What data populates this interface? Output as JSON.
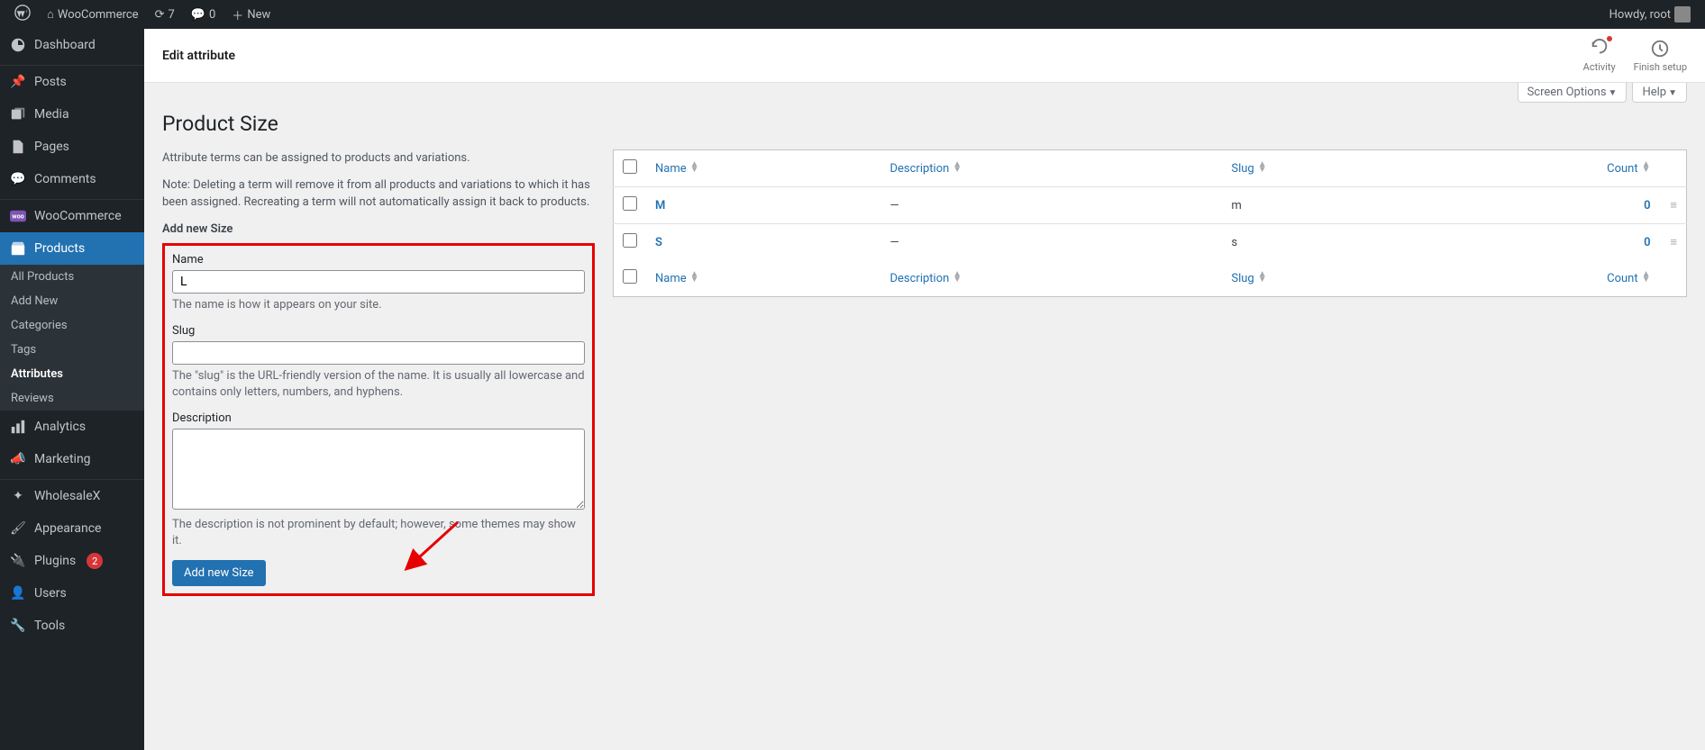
{
  "admin_bar": {
    "site_name": "WooCommerce",
    "updates": "7",
    "comments": "0",
    "new": "New",
    "howdy": "Howdy, root"
  },
  "sidebar": {
    "dashboard": "Dashboard",
    "posts": "Posts",
    "media": "Media",
    "pages": "Pages",
    "comments": "Comments",
    "woocommerce": "WooCommerce",
    "products": "Products",
    "submenu": {
      "all_products": "All Products",
      "add_new": "Add New",
      "categories": "Categories",
      "tags": "Tags",
      "attributes": "Attributes",
      "reviews": "Reviews"
    },
    "analytics": "Analytics",
    "marketing": "Marketing",
    "wholesalex": "WholesaleX",
    "appearance": "Appearance",
    "plugins": "Plugins",
    "plugins_badge": "2",
    "users": "Users",
    "tools": "Tools"
  },
  "topbar": {
    "title": "Edit attribute",
    "activity": "Activity",
    "finish_setup": "Finish setup"
  },
  "screen_meta": {
    "screen_options": "Screen Options",
    "help": "Help"
  },
  "page": {
    "title": "Product Size",
    "intro1": "Attribute terms can be assigned to products and variations.",
    "intro2": "Note: Deleting a term will remove it from all products and variations to which it has been assigned. Recreating a term will not automatically assign it back to products.",
    "add_heading": "Add new Size"
  },
  "form": {
    "name_label": "Name",
    "name_value": "L",
    "name_help": "The name is how it appears on your site.",
    "slug_label": "Slug",
    "slug_value": "",
    "slug_help": "The \"slug\" is the URL-friendly version of the name. It is usually all lowercase and contains only letters, numbers, and hyphens.",
    "desc_label": "Description",
    "desc_value": "",
    "desc_help": "The description is not prominent by default; however, some themes may show it.",
    "submit": "Add new Size"
  },
  "table": {
    "col_name": "Name",
    "col_description": "Description",
    "col_slug": "Slug",
    "col_count": "Count",
    "rows": [
      {
        "name": "M",
        "description": "—",
        "slug": "m",
        "count": "0"
      },
      {
        "name": "S",
        "description": "—",
        "slug": "s",
        "count": "0"
      }
    ]
  }
}
